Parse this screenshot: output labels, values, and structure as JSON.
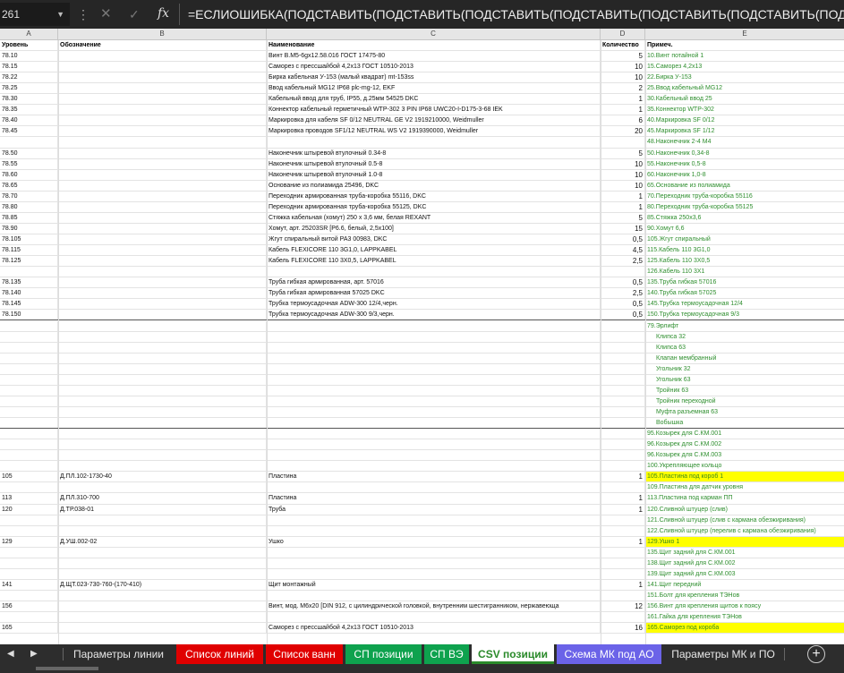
{
  "formula_bar": {
    "name_box": "261",
    "dots": "⋮",
    "cancel_icon": "✕",
    "enter_icon": "✓",
    "fx_label": "fx",
    "formula": "=ЕСЛИОШИБКА(ПОДСТАВИТЬ(ПОДСТАВИТЬ(ПОДСТАВИТЬ(ПОДСТАВИТЬ(ПОДСТАВИТЬ(ПОДСТАВИТЬ(ПОДСТАВИТЬ(ПОДСТАВИТЬ(ПОДСТАВ"
  },
  "columns": [
    "A",
    "B",
    "C",
    "D",
    "E"
  ],
  "header_row": {
    "a": "Уровень",
    "b": "Обозначение",
    "c": "Наименование",
    "d": "Количество",
    "e": "Примеч."
  },
  "rows": [
    {
      "a": "78.10",
      "b": "",
      "c": "Винт В.М5-6gx12.58.016 ГОСТ 17475-80",
      "d": "5",
      "e": "10.Винт потайной 1"
    },
    {
      "a": "78.15",
      "b": "",
      "c": "Саморез с прессшайбой 4,2х13 ГОСТ 10510-2013",
      "d": "10",
      "e": "15.Саморез 4,2х13"
    },
    {
      "a": "78.22",
      "b": "",
      "c": "Бирка кабельная У-153 (малый квадрат) mt-153ss",
      "d": "10",
      "e": "22.Бирка У-153"
    },
    {
      "a": "78.25",
      "b": "",
      "c": "Ввод кабельный MG12 IP68 plc-mg-12, EKF",
      "d": "2",
      "e": "25.Ввод кабельный MG12"
    },
    {
      "a": "78.30",
      "b": "",
      "c": "Кабельный ввод для труб, IP55, д.25мм 54525 DKC",
      "d": "1",
      "e": "30.Кабельный ввод 25"
    },
    {
      "a": "78.35",
      "b": "",
      "c": "Коннектор кабельный герметичный WTP-302 3 PIN IP68 UWC20-I-D175-3-68 IEK",
      "d": "1",
      "e": "35.Коннектор WTP-302"
    },
    {
      "a": "78.40",
      "b": "",
      "c": "Маркировка для кабеля SF 0/12 NEUTRAL GE V2 1919210000, Weidmuller",
      "d": "6",
      "e": "40.Маркировка SF 0/12"
    },
    {
      "a": "78.45",
      "b": "",
      "c": "Маркировка проводов SF1/12 NEUTRAL WS V2 1919390000, Weidmuller",
      "d": "20",
      "e": "45.Маркировка SF 1/12"
    },
    {
      "a": "",
      "b": "",
      "c": "",
      "d": "",
      "e": "48.Наконечник 2-4 М4"
    },
    {
      "a": "78.50",
      "b": "",
      "c": "Наконечник штыревой втулочный 0.34-8",
      "d": "5",
      "e": "50.Наконечник 0,34-8"
    },
    {
      "a": "78.55",
      "b": "",
      "c": "Наконечник штыревой втулочный 0.5-8",
      "d": "10",
      "e": "55.Наконечник 0,5-8"
    },
    {
      "a": "78.60",
      "b": "",
      "c": "Наконечник штыревой втулочный 1.0-8",
      "d": "10",
      "e": "60.Наконечник 1,0-8"
    },
    {
      "a": "78.65",
      "b": "",
      "c": "Основание из полиамида 25496, DKC",
      "d": "10",
      "e": "65.Основание из полиамида"
    },
    {
      "a": "78.70",
      "b": "",
      "c": "Переходник армированная труба-коробка 55116, DKC",
      "d": "1",
      "e": "70.Переходник труба-коробка 55116"
    },
    {
      "a": "78.80",
      "b": "",
      "c": "Переходник армированная труба-коробка 55125, DKC",
      "d": "1",
      "e": "80.Переходник труба-коробка 55125"
    },
    {
      "a": "78.85",
      "b": "",
      "c": "Стяжка кабельная (хомут) 250 х 3,6 мм, белая REXANT",
      "d": "5",
      "e": "85.Стяжка 250х3,6"
    },
    {
      "a": "78.90",
      "b": "",
      "c": "Хомут, арт. 25203SR [Р6.6, белый, 2,5х100]",
      "d": "15",
      "e": "90.Хомут 6,6"
    },
    {
      "a": "78.105",
      "b": "",
      "c": "Жгут спиральный витой РА3 00983, DKC",
      "d": "0,5",
      "e": "105.Жгут спиральный"
    },
    {
      "a": "78.115",
      "b": "",
      "c": "Кабель FLEXICORE 110 3G1,0, LAPPKABEL",
      "d": "4,5",
      "e": "115.Кабель 110 3G1,0"
    },
    {
      "a": "78.125",
      "b": "",
      "c": "Кабель FLEXICORE 110 3X0,5, LAPPKABEL",
      "d": "2,5",
      "e": "125.Кабель 110 3X0,5"
    },
    {
      "a": "",
      "b": "",
      "c": "",
      "d": "",
      "e": "126.Кабель 110 3X1"
    },
    {
      "a": "78.135",
      "b": "",
      "c": "Труба гибкая армированная, арт. 57016",
      "d": "0,5",
      "e": "135.Труба гибкая 57016"
    },
    {
      "a": "78.140",
      "b": "",
      "c": "Труба гибкая армированная 57025 DKC",
      "d": "2,5",
      "e": "140.Труба гибкая 57025"
    },
    {
      "a": "78.145",
      "b": "",
      "c": "Трубка термоусадочная ADW-300 12/4,черн.",
      "d": "0,5",
      "e": "145.Трубка термоусадочная 12/4"
    },
    {
      "a": "78.150",
      "b": "",
      "c": "Трубка термоусадочная ADW-300 9/3,черн.",
      "d": "0,5",
      "e": "150.Трубка термоусадочная 9/3",
      "thick": true
    },
    {
      "a": "",
      "b": "",
      "c": "",
      "d": "",
      "e": "79.Эрлифт"
    },
    {
      "a": "",
      "b": "",
      "c": "",
      "d": "",
      "e": "Клипса 32",
      "ind": true
    },
    {
      "a": "",
      "b": "",
      "c": "",
      "d": "",
      "e": "Клипса 63",
      "ind": true
    },
    {
      "a": "",
      "b": "",
      "c": "",
      "d": "",
      "e": "Клапан мембранный",
      "ind": true
    },
    {
      "a": "",
      "b": "",
      "c": "",
      "d": "",
      "e": "Угольник 32",
      "ind": true
    },
    {
      "a": "",
      "b": "",
      "c": "",
      "d": "",
      "e": "Угольник 63",
      "ind": true
    },
    {
      "a": "",
      "b": "",
      "c": "",
      "d": "",
      "e": "Тройник 63",
      "ind": true
    },
    {
      "a": "",
      "b": "",
      "c": "",
      "d": "",
      "e": "Тройник переходной",
      "ind": true
    },
    {
      "a": "",
      "b": "",
      "c": "",
      "d": "",
      "e": "Муфта разъемная 63",
      "ind": true
    },
    {
      "a": "",
      "b": "",
      "c": "",
      "d": "",
      "e": "Вобышка",
      "ind": true,
      "thick": true
    },
    {
      "a": "",
      "b": "",
      "c": "",
      "d": "",
      "e": "95.Козырек для С.КМ.001"
    },
    {
      "a": "",
      "b": "",
      "c": "",
      "d": "",
      "e": "96.Козырек для С.КМ.002"
    },
    {
      "a": "",
      "b": "",
      "c": "",
      "d": "",
      "e": "96.Козырек для С.КМ.003"
    },
    {
      "a": "",
      "b": "",
      "c": "",
      "d": "",
      "e": "100.Укрепляющее кольцо"
    },
    {
      "a": "105",
      "b": "Д.ПЛ.102-1730-40",
      "c": "Пластина",
      "d": "1",
      "e": "105.Пластина под короб 1",
      "hl": true
    },
    {
      "a": "",
      "b": "",
      "c": "",
      "d": "",
      "e": "109.Пластина для датчик уровня"
    },
    {
      "a": "113",
      "b": "Д.ПЛ.310-700",
      "c": "Пластина",
      "d": "1",
      "e": "113.Пластина под карман ПП"
    },
    {
      "a": "120",
      "b": "Д.ТР.038-01",
      "c": "Труба",
      "d": "1",
      "e": "120.Сливной штуцер (слив)"
    },
    {
      "a": "",
      "b": "",
      "c": "",
      "d": "",
      "e": "121.Сливной штуцер (слив с кармана обезжиривания)"
    },
    {
      "a": "",
      "b": "",
      "c": "",
      "d": "",
      "e": "122.Сливной штуцер (перелив с кармана обезжиривания)"
    },
    {
      "a": "129",
      "b": "Д.УШ.002-02",
      "c": "Ушко",
      "d": "1",
      "e": "129.Ушко 1",
      "hl": true
    },
    {
      "a": "",
      "b": "",
      "c": "",
      "d": "",
      "e": "135.Щит задний для С.КМ.001"
    },
    {
      "a": "",
      "b": "",
      "c": "",
      "d": "",
      "e": "138.Щит задний для С.КМ.002"
    },
    {
      "a": "",
      "b": "",
      "c": "",
      "d": "",
      "e": "139.Щит задний для С.КМ.003"
    },
    {
      "a": "141",
      "b": "Д.ЩТ.023-730-760-(170-410)",
      "c": "Щит монтажный",
      "d": "1",
      "e": "141.Щит передний"
    },
    {
      "a": "",
      "b": "",
      "c": "",
      "d": "",
      "e": "151.Болт для крепления ТЭНов"
    },
    {
      "a": "156",
      "b": "",
      "c": "Винт, мод. М6х20 [DIN 912, с цилиндрической головкой, внутренним шестигранником, нержавеюща",
      "d": "12",
      "e": "156.Винт для крепления щитов к поясу"
    },
    {
      "a": "",
      "b": "",
      "c": "",
      "d": "",
      "e": "161.Гайка для крепления ТЭНов"
    },
    {
      "a": "165",
      "b": "",
      "c": "Саморез с прессшайбой 4,2х13 ГОСТ 10510-2013",
      "d": "16",
      "e": "165.Саморез под короба",
      "hl": true
    }
  ],
  "tabs": {
    "nav_prev": "◀",
    "nav_next": "▶",
    "items": [
      {
        "label": "Параметры линии",
        "style": "plain"
      },
      {
        "label": "Список линий",
        "style": "red"
      },
      {
        "label": "Список ванн",
        "style": "red"
      },
      {
        "label": "СП позиции",
        "style": "green"
      },
      {
        "label": "СП ВЭ",
        "style": "green"
      },
      {
        "label": "CSV позиции",
        "style": "active"
      },
      {
        "label": "Схема МК под АО",
        "style": "blue"
      },
      {
        "label": "Параметры МК и ПО",
        "style": "plain"
      }
    ],
    "add_label": "+"
  },
  "colors": {
    "accent_green": "#0ea24e",
    "red_tab": "#e00000",
    "blue_tab": "#6b63e8",
    "highlight": "#ffff00",
    "note_text": "#2f8f2f"
  }
}
